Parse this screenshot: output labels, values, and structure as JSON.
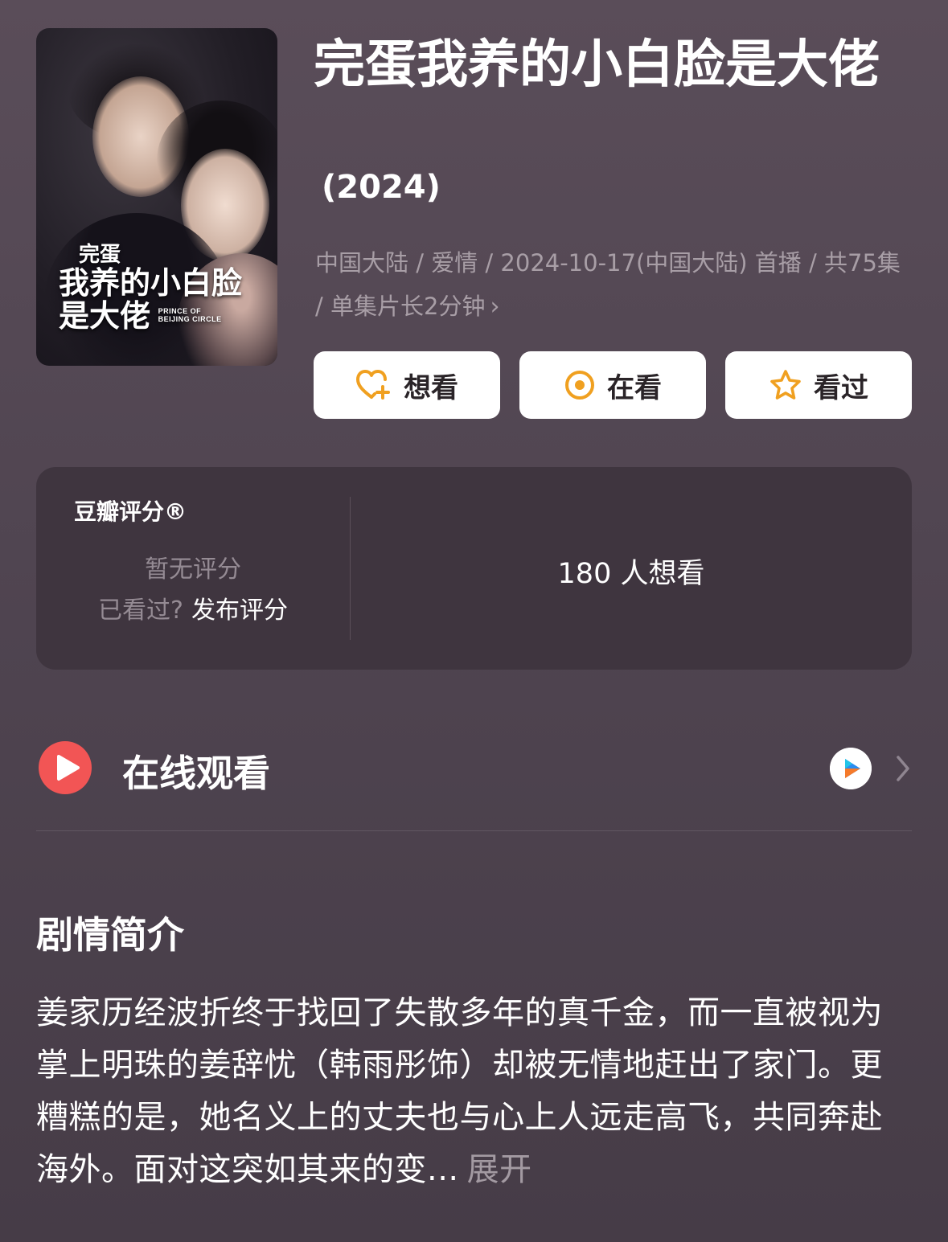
{
  "poster": {
    "title_line1": "完蛋",
    "title_line2": "我养的小白脸",
    "title_line3": "是大佬",
    "english_line1": "PRINCE OF",
    "english_line2": "BEIJING CIRCLE"
  },
  "title": "完蛋我养的小白脸是大佬",
  "year": "(2024)",
  "meta": "中国大陆 / 爱情 / 2024-10-17(中国大陆) 首播 / 共75集 / 单集片长2分钟",
  "actions": {
    "want": "想看",
    "watching": "在看",
    "watched": "看过"
  },
  "rating": {
    "label": "豆瓣评分®",
    "no_rating": "暂无评分",
    "watched_q": "已看过?",
    "publish": "发布评分",
    "want_count": "180 人想看"
  },
  "online": {
    "title": "在线观看"
  },
  "synopsis": {
    "heading": "剧情简介",
    "text": "姜家历经波折终于找回了失散多年的真千金，而一直被视为掌上明珠的姜辞忧（韩雨彤饰）却被无情地赶出了家门。更糟糕的是，她名义上的丈夫也与心上人远走高飞，共同奔赴海外。面对这突如其来的变...",
    "expand": "展开"
  },
  "colors": {
    "accent_orange": "#f0a020",
    "play_red": "#f25555"
  }
}
